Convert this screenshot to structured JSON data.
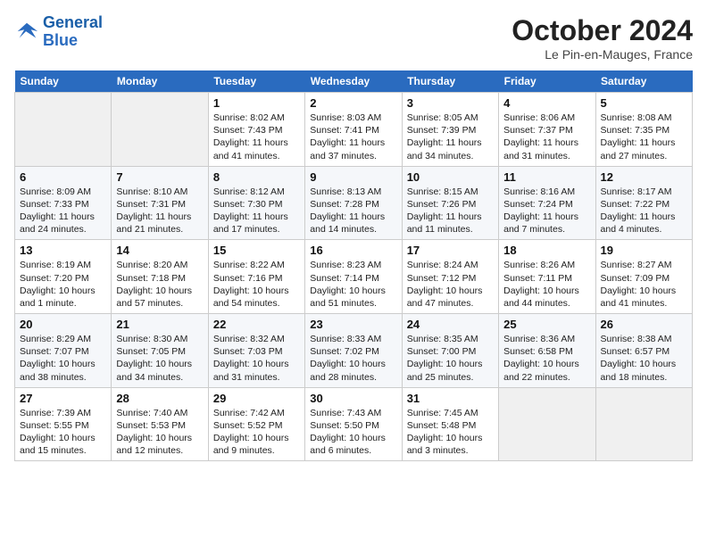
{
  "header": {
    "logo_line1": "General",
    "logo_line2": "Blue",
    "month_title": "October 2024",
    "location": "Le Pin-en-Mauges, France"
  },
  "weekdays": [
    "Sunday",
    "Monday",
    "Tuesday",
    "Wednesday",
    "Thursday",
    "Friday",
    "Saturday"
  ],
  "weeks": [
    [
      null,
      null,
      {
        "day": 1,
        "sunrise": "8:02 AM",
        "sunset": "7:43 PM",
        "daylight": "11 hours and 41 minutes."
      },
      {
        "day": 2,
        "sunrise": "8:03 AM",
        "sunset": "7:41 PM",
        "daylight": "11 hours and 37 minutes."
      },
      {
        "day": 3,
        "sunrise": "8:05 AM",
        "sunset": "7:39 PM",
        "daylight": "11 hours and 34 minutes."
      },
      {
        "day": 4,
        "sunrise": "8:06 AM",
        "sunset": "7:37 PM",
        "daylight": "11 hours and 31 minutes."
      },
      {
        "day": 5,
        "sunrise": "8:08 AM",
        "sunset": "7:35 PM",
        "daylight": "11 hours and 27 minutes."
      }
    ],
    [
      {
        "day": 6,
        "sunrise": "8:09 AM",
        "sunset": "7:33 PM",
        "daylight": "11 hours and 24 minutes."
      },
      {
        "day": 7,
        "sunrise": "8:10 AM",
        "sunset": "7:31 PM",
        "daylight": "11 hours and 21 minutes."
      },
      {
        "day": 8,
        "sunrise": "8:12 AM",
        "sunset": "7:30 PM",
        "daylight": "11 hours and 17 minutes."
      },
      {
        "day": 9,
        "sunrise": "8:13 AM",
        "sunset": "7:28 PM",
        "daylight": "11 hours and 14 minutes."
      },
      {
        "day": 10,
        "sunrise": "8:15 AM",
        "sunset": "7:26 PM",
        "daylight": "11 hours and 11 minutes."
      },
      {
        "day": 11,
        "sunrise": "8:16 AM",
        "sunset": "7:24 PM",
        "daylight": "11 hours and 7 minutes."
      },
      {
        "day": 12,
        "sunrise": "8:17 AM",
        "sunset": "7:22 PM",
        "daylight": "11 hours and 4 minutes."
      }
    ],
    [
      {
        "day": 13,
        "sunrise": "8:19 AM",
        "sunset": "7:20 PM",
        "daylight": "10 hours and 1 minute."
      },
      {
        "day": 14,
        "sunrise": "8:20 AM",
        "sunset": "7:18 PM",
        "daylight": "10 hours and 57 minutes."
      },
      {
        "day": 15,
        "sunrise": "8:22 AM",
        "sunset": "7:16 PM",
        "daylight": "10 hours and 54 minutes."
      },
      {
        "day": 16,
        "sunrise": "8:23 AM",
        "sunset": "7:14 PM",
        "daylight": "10 hours and 51 minutes."
      },
      {
        "day": 17,
        "sunrise": "8:24 AM",
        "sunset": "7:12 PM",
        "daylight": "10 hours and 47 minutes."
      },
      {
        "day": 18,
        "sunrise": "8:26 AM",
        "sunset": "7:11 PM",
        "daylight": "10 hours and 44 minutes."
      },
      {
        "day": 19,
        "sunrise": "8:27 AM",
        "sunset": "7:09 PM",
        "daylight": "10 hours and 41 minutes."
      }
    ],
    [
      {
        "day": 20,
        "sunrise": "8:29 AM",
        "sunset": "7:07 PM",
        "daylight": "10 hours and 38 minutes."
      },
      {
        "day": 21,
        "sunrise": "8:30 AM",
        "sunset": "7:05 PM",
        "daylight": "10 hours and 34 minutes."
      },
      {
        "day": 22,
        "sunrise": "8:32 AM",
        "sunset": "7:03 PM",
        "daylight": "10 hours and 31 minutes."
      },
      {
        "day": 23,
        "sunrise": "8:33 AM",
        "sunset": "7:02 PM",
        "daylight": "10 hours and 28 minutes."
      },
      {
        "day": 24,
        "sunrise": "8:35 AM",
        "sunset": "7:00 PM",
        "daylight": "10 hours and 25 minutes."
      },
      {
        "day": 25,
        "sunrise": "8:36 AM",
        "sunset": "6:58 PM",
        "daylight": "10 hours and 22 minutes."
      },
      {
        "day": 26,
        "sunrise": "8:38 AM",
        "sunset": "6:57 PM",
        "daylight": "10 hours and 18 minutes."
      }
    ],
    [
      {
        "day": 27,
        "sunrise": "7:39 AM",
        "sunset": "5:55 PM",
        "daylight": "10 hours and 15 minutes."
      },
      {
        "day": 28,
        "sunrise": "7:40 AM",
        "sunset": "5:53 PM",
        "daylight": "10 hours and 12 minutes."
      },
      {
        "day": 29,
        "sunrise": "7:42 AM",
        "sunset": "5:52 PM",
        "daylight": "10 hours and 9 minutes."
      },
      {
        "day": 30,
        "sunrise": "7:43 AM",
        "sunset": "5:50 PM",
        "daylight": "10 hours and 6 minutes."
      },
      {
        "day": 31,
        "sunrise": "7:45 AM",
        "sunset": "5:48 PM",
        "daylight": "10 hours and 3 minutes."
      },
      null,
      null
    ]
  ]
}
